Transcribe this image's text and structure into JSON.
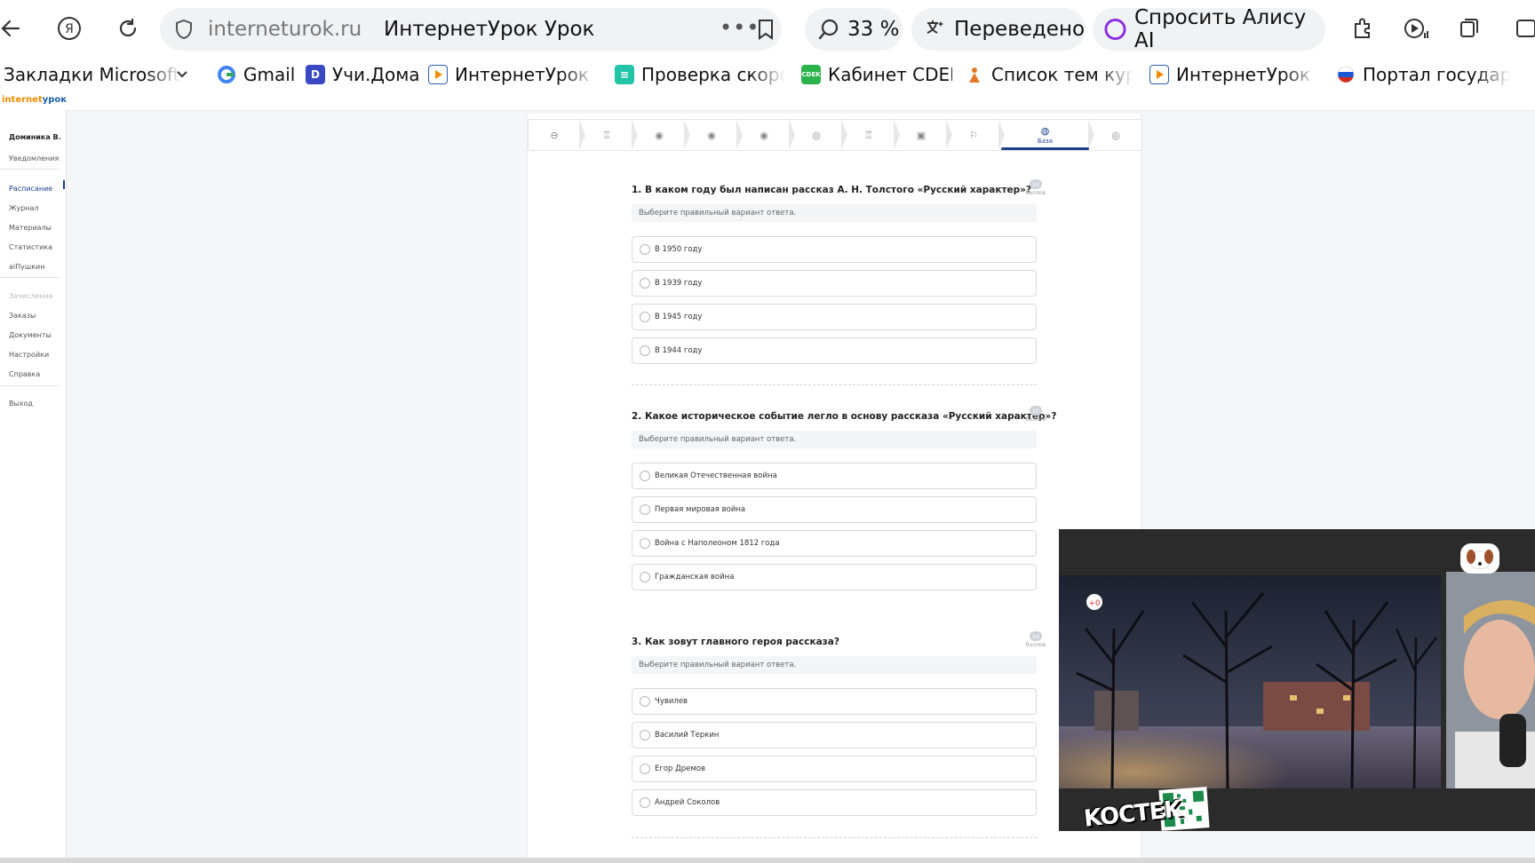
{
  "browser": {
    "url_domain": "interneturok.ru",
    "page_title": "ИнтернетУрок Урок",
    "zoom": "33 %",
    "translated_label": "Переведено",
    "alice_label": "Спросить Алису AI"
  },
  "bookmarks": [
    {
      "label": "Закладки Microsoft E",
      "color": "#ffffff"
    },
    {
      "label": "Gmail",
      "color": "#ffffff"
    },
    {
      "label": "Учи.Дома",
      "color": "#3b48c6"
    },
    {
      "label": "ИнтернетУрок Ра",
      "color": "#2f5db8"
    },
    {
      "label": "Проверка скорос",
      "color": "#22c5a8"
    },
    {
      "label": "Кабинет CDEK",
      "color": "#2bb34b"
    },
    {
      "label": "Список тем курса",
      "color": "#e07a2a"
    },
    {
      "label": "ИнтернетУрок Ра",
      "color": "#2f5db8"
    },
    {
      "label": "Портал государст",
      "color": "#d33"
    }
  ],
  "site": {
    "logo_a": "internet",
    "logo_b": "урок",
    "sidebar": {
      "user": "Доминика В.",
      "notifications": "Уведомления",
      "schedule": "Расписание",
      "journal": "Журнал",
      "materials": "Материалы",
      "stats": "Статистика",
      "aipushkin": "aiПушкин",
      "enrollment": "Зачисление",
      "orders": "Заказы",
      "documents": "Документы",
      "settings": "Настройки",
      "help": "Справка",
      "logout": "Выход"
    },
    "active_step_label": "База"
  },
  "questions": [
    {
      "title": "1. В каком году был написан рассказ А. Н. Толстого «Русский характер»?",
      "points": "10",
      "points_label": "баллов",
      "hint": "Выберите правильный вариант ответа.",
      "options": [
        "В 1950 году",
        "В 1939 году",
        "В 1945 году",
        "В 1944 году"
      ]
    },
    {
      "title": "2. Какое историческое событие легло в основу рассказа «Русский характер»?",
      "points": "10",
      "points_label": "баллов",
      "hint": "Выберите правильный вариант ответа.",
      "options": [
        "Великая Отечественная война",
        "Первая мировая война",
        "Война с Наполеоном 1812 года",
        "Гражданская война"
      ]
    },
    {
      "title": "3. Как зовут главного героя рассказа?",
      "points": "10",
      "points_label": "баллов",
      "hint": "Выберите правильный вариант ответа.",
      "options": [
        "Чувилев",
        "Василий Теркин",
        "Егор Дремов",
        "Андрей Соколов"
      ]
    }
  ],
  "overlay": {
    "stream_text": "KOCTEK"
  }
}
